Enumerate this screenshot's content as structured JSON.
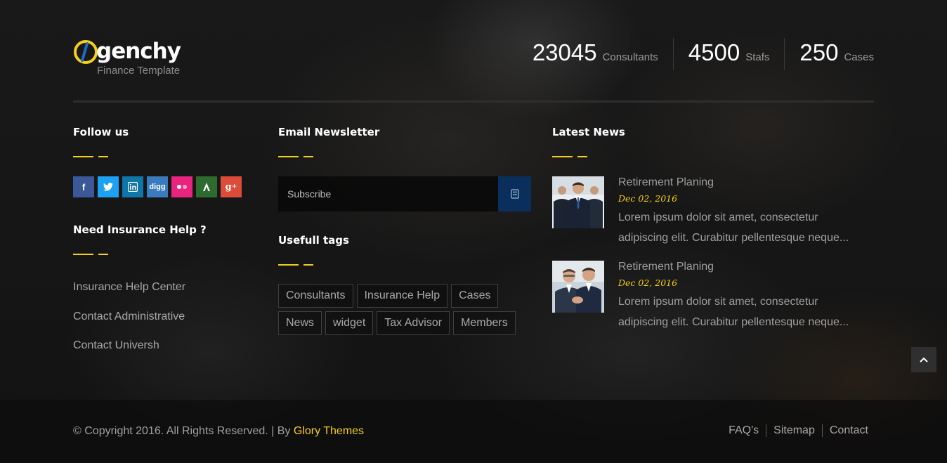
{
  "brand": {
    "name": "genchy",
    "tagline": "Finance Template",
    "accent_color": "#f5cf1a"
  },
  "stats": [
    {
      "number": "23045",
      "label": "Consultants"
    },
    {
      "number": "4500",
      "label": "Stafs"
    },
    {
      "number": "250",
      "label": "Cases"
    }
  ],
  "follow": {
    "title": "Follow us",
    "networks": [
      {
        "icon": "facebook-icon",
        "glyph": "f",
        "color": "#3b5998"
      },
      {
        "icon": "twitter-icon",
        "glyph": "🐦",
        "color": "#1da1f2"
      },
      {
        "icon": "linkedin-icon",
        "glyph": "in",
        "color": "#0e76a8"
      },
      {
        "icon": "digg-icon",
        "glyph": "digg",
        "color": "#3a7bbf"
      },
      {
        "icon": "flickr-icon",
        "glyph": "●●",
        "color": "#e9247e"
      },
      {
        "icon": "vine-icon",
        "glyph": "A",
        "color": "#2e6b2e"
      },
      {
        "icon": "google-plus-icon",
        "glyph": "g+",
        "color": "#dd4b39"
      }
    ]
  },
  "help": {
    "title": "Need Insurance Help ?",
    "links": [
      "Insurance Help Center",
      "Contact Administrative",
      "Contact Universh"
    ]
  },
  "newsletter": {
    "title": "Email Newsletter",
    "placeholder": "Subscribe",
    "button_icon": "send-icon"
  },
  "tags": {
    "title": "Usefull tags",
    "items": [
      "Consultants",
      "Insurance Help",
      "Cases",
      "News",
      "widget",
      "Tax Advisor",
      "Members"
    ]
  },
  "news": {
    "title": "Latest News",
    "items": [
      {
        "title": "Retirement Planing",
        "date": "Dec 02, 2016",
        "excerpt": "Lorem ipsum dolor sit amet, consectetur adipiscing elit. Curabitur pellentesque neque..."
      },
      {
        "title": "Retirement Planing",
        "date": "Dec 02, 2016",
        "excerpt": "Lorem ipsum dolor sit amet, consectetur adipiscing elit. Curabitur pellentesque neque..."
      }
    ]
  },
  "footer": {
    "copyright": "© Copyright 2016. All Rights Reserved. | By ",
    "author": "Glory Themes",
    "links": [
      "FAQ's",
      "Sitemap",
      "Contact"
    ]
  }
}
